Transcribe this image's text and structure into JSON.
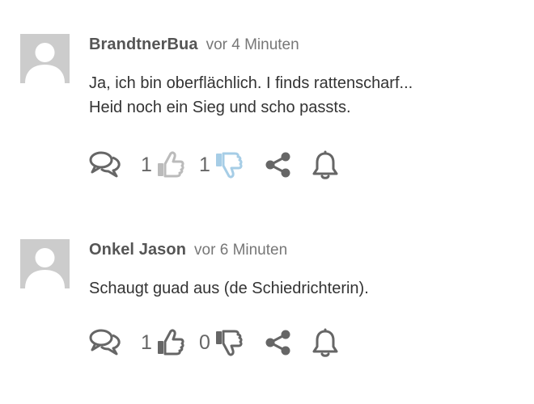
{
  "colors": {
    "text": "#333333",
    "author": "#555555",
    "muted": "#777777",
    "icon": "#666666",
    "thumb_up_light": "#bbbbbb",
    "thumb_down_active": "#a6cde6",
    "avatar_bg": "#cccccc"
  },
  "comments": [
    {
      "author": "BrandtnerBua",
      "time": "vor 4 Minuten",
      "lines": [
        "Ja, ich bin oberflächlich. I finds rattenscharf...",
        "Heid noch ein Sieg und scho passts."
      ],
      "upvotes": "1",
      "downvotes": "1",
      "icons": [
        "reply-icon",
        "thumbs-up-icon",
        "thumbs-down-icon",
        "share-icon",
        "bell-icon"
      ]
    },
    {
      "author": "Onkel Jason",
      "time": "vor 6 Minuten",
      "lines": [
        "Schaugt guad aus (de Schiedrichterin)."
      ],
      "upvotes": "1",
      "downvotes": "0",
      "icons": [
        "reply-icon",
        "thumbs-up-icon",
        "thumbs-down-icon",
        "share-icon",
        "bell-icon"
      ]
    }
  ]
}
